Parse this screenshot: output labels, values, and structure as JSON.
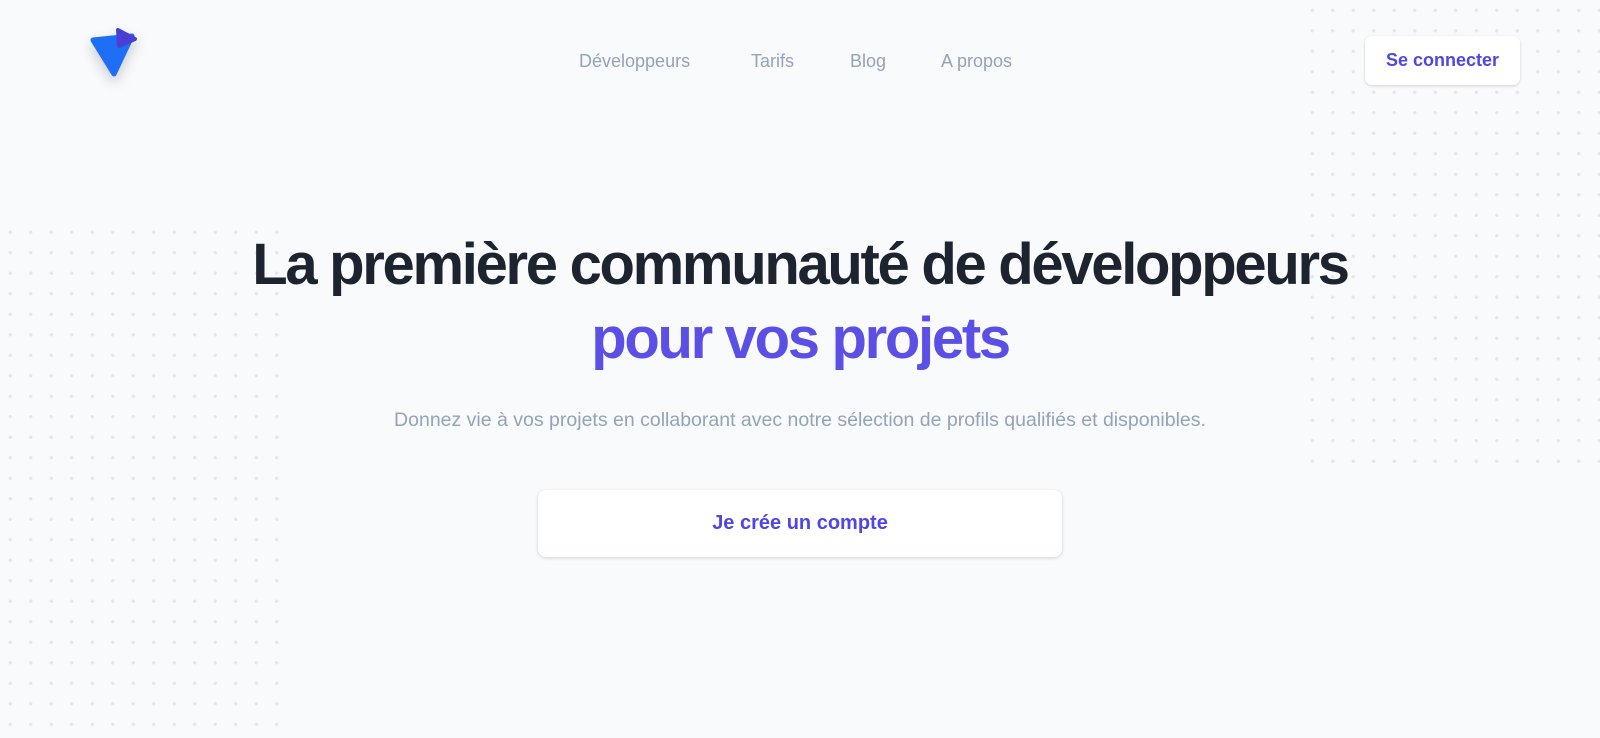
{
  "brand": {
    "logo_icon": "triangle-logo-icon",
    "colors": {
      "logo_primary": "#1e6ff5",
      "logo_secondary": "#4b3fd1",
      "accent": "#5b4fe6",
      "heading": "#1e2330",
      "muted": "#94a3b8",
      "background": "#f8fafc"
    }
  },
  "nav": {
    "links": [
      {
        "label": "Développeurs"
      },
      {
        "label": "Tarifs"
      },
      {
        "label": "Blog"
      },
      {
        "label": "A propos"
      }
    ],
    "login_label": "Se connecter"
  },
  "hero": {
    "title_line1": "La première communauté de développeurs",
    "title_line2": "pour vos projets",
    "subtitle": "Donnez vie à vos projets en collaborant avec notre sélection de profils qualifiés et disponibles.",
    "cta_label": "Je crée un compte"
  }
}
